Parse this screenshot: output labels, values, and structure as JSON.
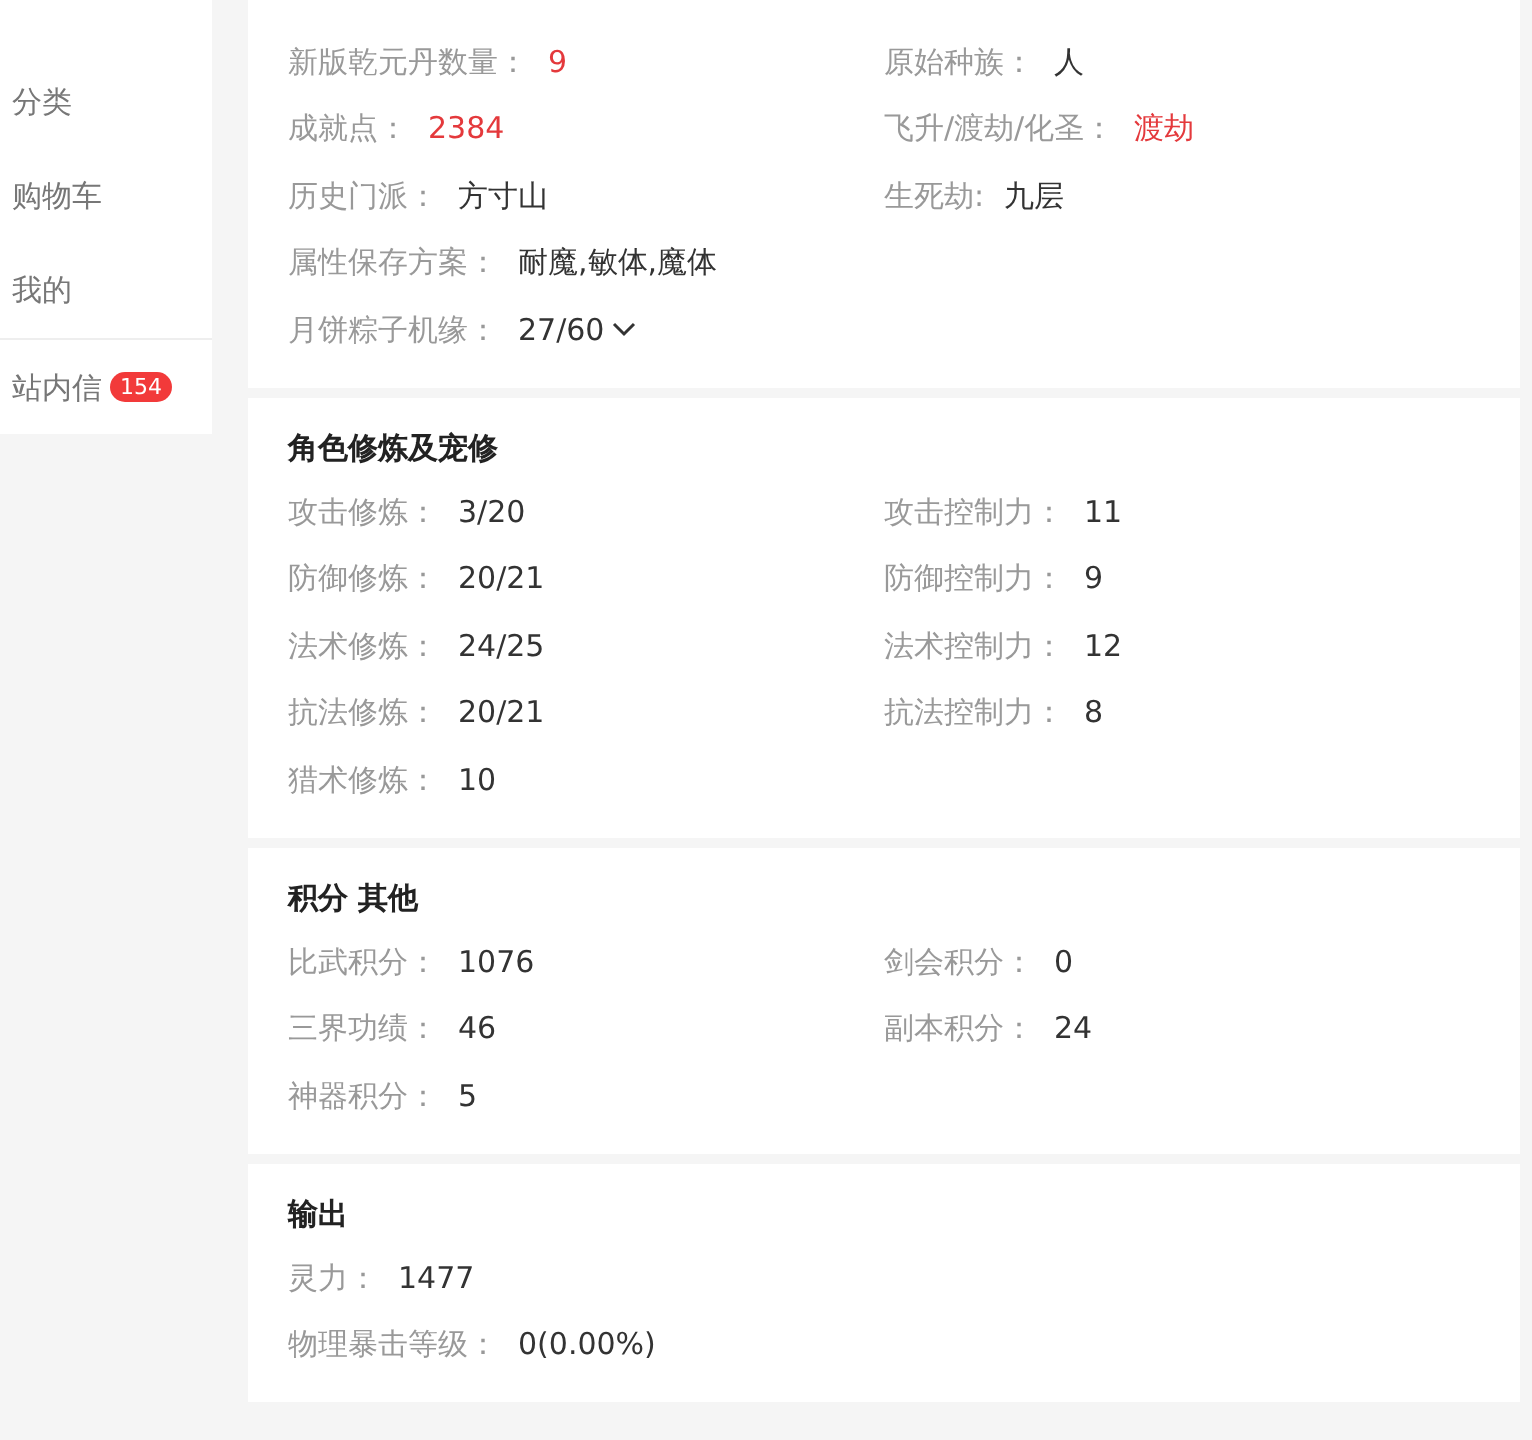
{
  "sidebar": {
    "sections": [
      {
        "items": [
          {
            "label": "分类"
          },
          {
            "label": "购物车"
          },
          {
            "label": "我的"
          }
        ]
      },
      {
        "items": [
          {
            "label": "站内信",
            "badge": "154"
          }
        ]
      }
    ]
  },
  "cards": [
    {
      "rows": [
        [
          {
            "label": "新版乾元丹数量：",
            "value": "9",
            "kind": "highlight"
          },
          {
            "label": "原始种族：",
            "value": "人",
            "kind": "plain"
          }
        ],
        [
          {
            "label": "成就点：",
            "value": "2384",
            "kind": "highlight"
          },
          {
            "label": "飞升/渡劫/化圣：",
            "value": "渡劫",
            "kind": "highlight"
          }
        ],
        [
          {
            "label": "历史门派：",
            "value": "方寸山",
            "kind": "plain"
          },
          {
            "label": "生死劫:",
            "value": "九层",
            "kind": "plain"
          }
        ],
        [
          {
            "label": "属性保存方案：",
            "value": "耐魔,敏体,魔体",
            "kind": "plain"
          }
        ],
        [
          {
            "label": "月饼粽子机缘：",
            "value": "27/60",
            "kind": "dropdown"
          }
        ]
      ]
    },
    {
      "title": "角色修炼及宠修",
      "rows": [
        [
          {
            "label": "攻击修炼：",
            "value": "3/20",
            "kind": "plain"
          },
          {
            "label": "攻击控制力：",
            "value": "11",
            "kind": "plain"
          }
        ],
        [
          {
            "label": "防御修炼：",
            "value": "20/21",
            "kind": "plain"
          },
          {
            "label": "防御控制力：",
            "value": "9",
            "kind": "plain"
          }
        ],
        [
          {
            "label": "法术修炼：",
            "value": "24/25",
            "kind": "plain"
          },
          {
            "label": "法术控制力：",
            "value": "12",
            "kind": "plain"
          }
        ],
        [
          {
            "label": "抗法修炼：",
            "value": "20/21",
            "kind": "plain"
          },
          {
            "label": "抗法控制力：",
            "value": "8",
            "kind": "plain"
          }
        ],
        [
          {
            "label": "猎术修炼：",
            "value": "10",
            "kind": "plain"
          }
        ]
      ]
    },
    {
      "title": "积分 其他",
      "rows": [
        [
          {
            "label": "比武积分：",
            "value": "1076",
            "kind": "plain"
          },
          {
            "label": "剑会积分：",
            "value": "0",
            "kind": "plain"
          }
        ],
        [
          {
            "label": "三界功绩：",
            "value": "46",
            "kind": "plain"
          },
          {
            "label": "副本积分：",
            "value": "24",
            "kind": "plain"
          }
        ],
        [
          {
            "label": "神器积分：",
            "value": "5",
            "kind": "plain"
          }
        ]
      ]
    },
    {
      "title": "输出",
      "rows": [
        [
          {
            "label": "灵力：",
            "value": "1477",
            "kind": "plain"
          }
        ],
        [
          {
            "label": "物理暴击等级：",
            "value": "0(0.00%)",
            "kind": "plain"
          }
        ]
      ]
    }
  ]
}
